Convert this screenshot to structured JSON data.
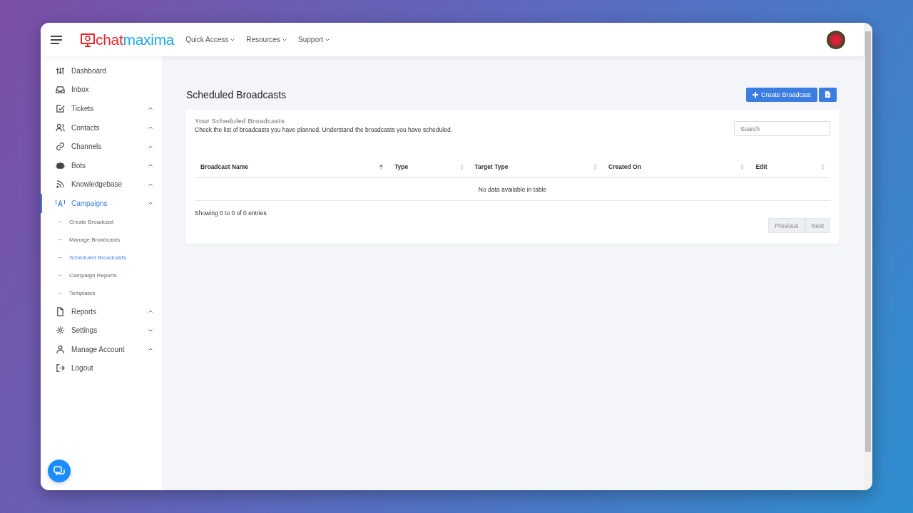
{
  "header": {
    "logo": {
      "part_1": "chat",
      "part_2": "maxima"
    },
    "menus": [
      {
        "label": "Quick Access"
      },
      {
        "label": "Resources"
      },
      {
        "label": "Support"
      }
    ]
  },
  "sidebar": {
    "items": [
      {
        "label": "Dashboard",
        "kind": "link",
        "selected": false
      },
      {
        "label": "Inbox",
        "kind": "link",
        "selected": false
      },
      {
        "label": "Tickets",
        "kind": "group",
        "selected": false,
        "expanded": true
      },
      {
        "label": "Contacts",
        "kind": "group",
        "selected": false,
        "expanded": true
      },
      {
        "label": "Channels",
        "kind": "group",
        "selected": false,
        "expanded": true
      },
      {
        "label": "Bots",
        "kind": "group",
        "selected": false,
        "expanded": true
      },
      {
        "label": "Knowledgebase",
        "kind": "group",
        "selected": false,
        "expanded": true
      },
      {
        "label": "Campaigns",
        "kind": "group",
        "selected": true,
        "expanded": true,
        "children": [
          {
            "label": "Create Broadcast",
            "selected": false
          },
          {
            "label": "Manage Broadcasts",
            "selected": false
          },
          {
            "label": "Scheduled Broadcasts",
            "selected": true
          },
          {
            "label": "Campaign Reports",
            "selected": false
          },
          {
            "label": "Templates",
            "selected": false
          }
        ]
      },
      {
        "label": "Reports",
        "kind": "group",
        "selected": false,
        "expanded": true
      },
      {
        "label": "Settings",
        "kind": "group",
        "selected": false,
        "expanded": false
      },
      {
        "label": "Manage Account",
        "kind": "group",
        "selected": false,
        "expanded": true
      },
      {
        "label": "Logout",
        "kind": "link",
        "selected": false
      }
    ]
  },
  "page": {
    "title": "Scheduled Broadcasts",
    "create_button": "Create Broadcast"
  },
  "card": {
    "title": "Your Scheduled Broadcasts",
    "description": "Check the list of broadcasts you have planned. Understand the broadcasts you have scheduled.",
    "search": {
      "placeholder": "Search"
    },
    "table": {
      "columns": [
        {
          "label": "Broadcast Name",
          "sorted": true
        },
        {
          "label": "Type",
          "sorted": false
        },
        {
          "label": "Target Type",
          "sorted": false
        },
        {
          "label": "Created On",
          "sorted": false
        },
        {
          "label": "Edit",
          "sorted": false
        }
      ],
      "empty_message": "No data available in table"
    },
    "info": "Showing 0 to 0 of 0 entries",
    "pagination": [
      {
        "label": "Previous",
        "disabled": true
      },
      {
        "label": "Next",
        "disabled": true
      }
    ]
  }
}
